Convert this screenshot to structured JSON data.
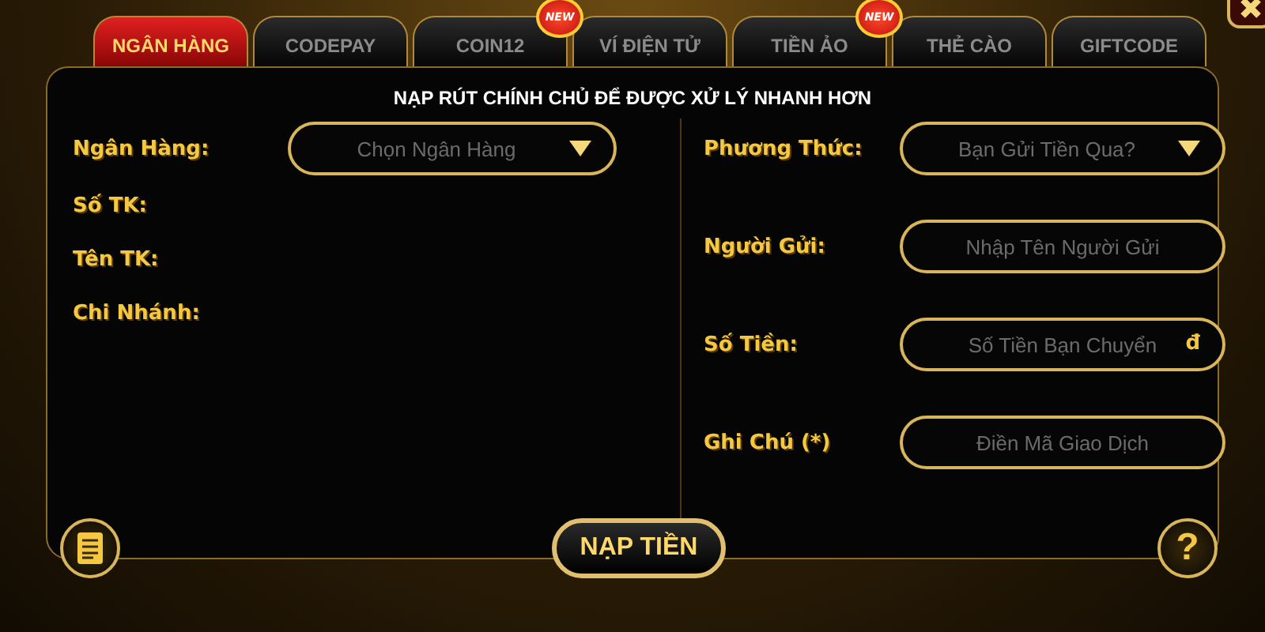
{
  "tabs": [
    {
      "label": "NGÂN HÀNG",
      "selected": true
    },
    {
      "label": "CODEPAY",
      "selected": false
    },
    {
      "label": "COIN12",
      "selected": false,
      "badge": "NEW"
    },
    {
      "label": "VÍ ĐIỆN TỬ",
      "selected": false
    },
    {
      "label": "TIỀN ẢO",
      "selected": false,
      "badge": "NEW"
    },
    {
      "label": "THẺ CÀO",
      "selected": false
    },
    {
      "label": "GIFTCODE",
      "selected": false
    }
  ],
  "notice": "NẠP RÚT CHÍNH CHỦ ĐỂ ĐƯỢC XỬ LÝ NHANH HƠN",
  "bank": {
    "label": "Ngân Hàng:",
    "placeholder": "Chọn Ngân Hàng"
  },
  "bank_info": [
    "Số TK:",
    "Tên TK:",
    "Chi Nhánh:"
  ],
  "fields": [
    {
      "kind": "dropdown",
      "label": "Phương Thức:",
      "placeholder": "Bạn Gửi Tiền Qua?"
    },
    {
      "kind": "input",
      "label": "Người Gửi:",
      "placeholder": "Nhập Tên Người Gửi"
    },
    {
      "kind": "input",
      "label": "Số Tiền:",
      "placeholder": "Số Tiền Bạn Chuyển",
      "suffix": "đ"
    },
    {
      "kind": "input",
      "label": "Ghi Chú (*)",
      "placeholder": "Điền Mã Giao Dịch"
    }
  ],
  "submit": "NẠP TIỀN",
  "help": "?"
}
